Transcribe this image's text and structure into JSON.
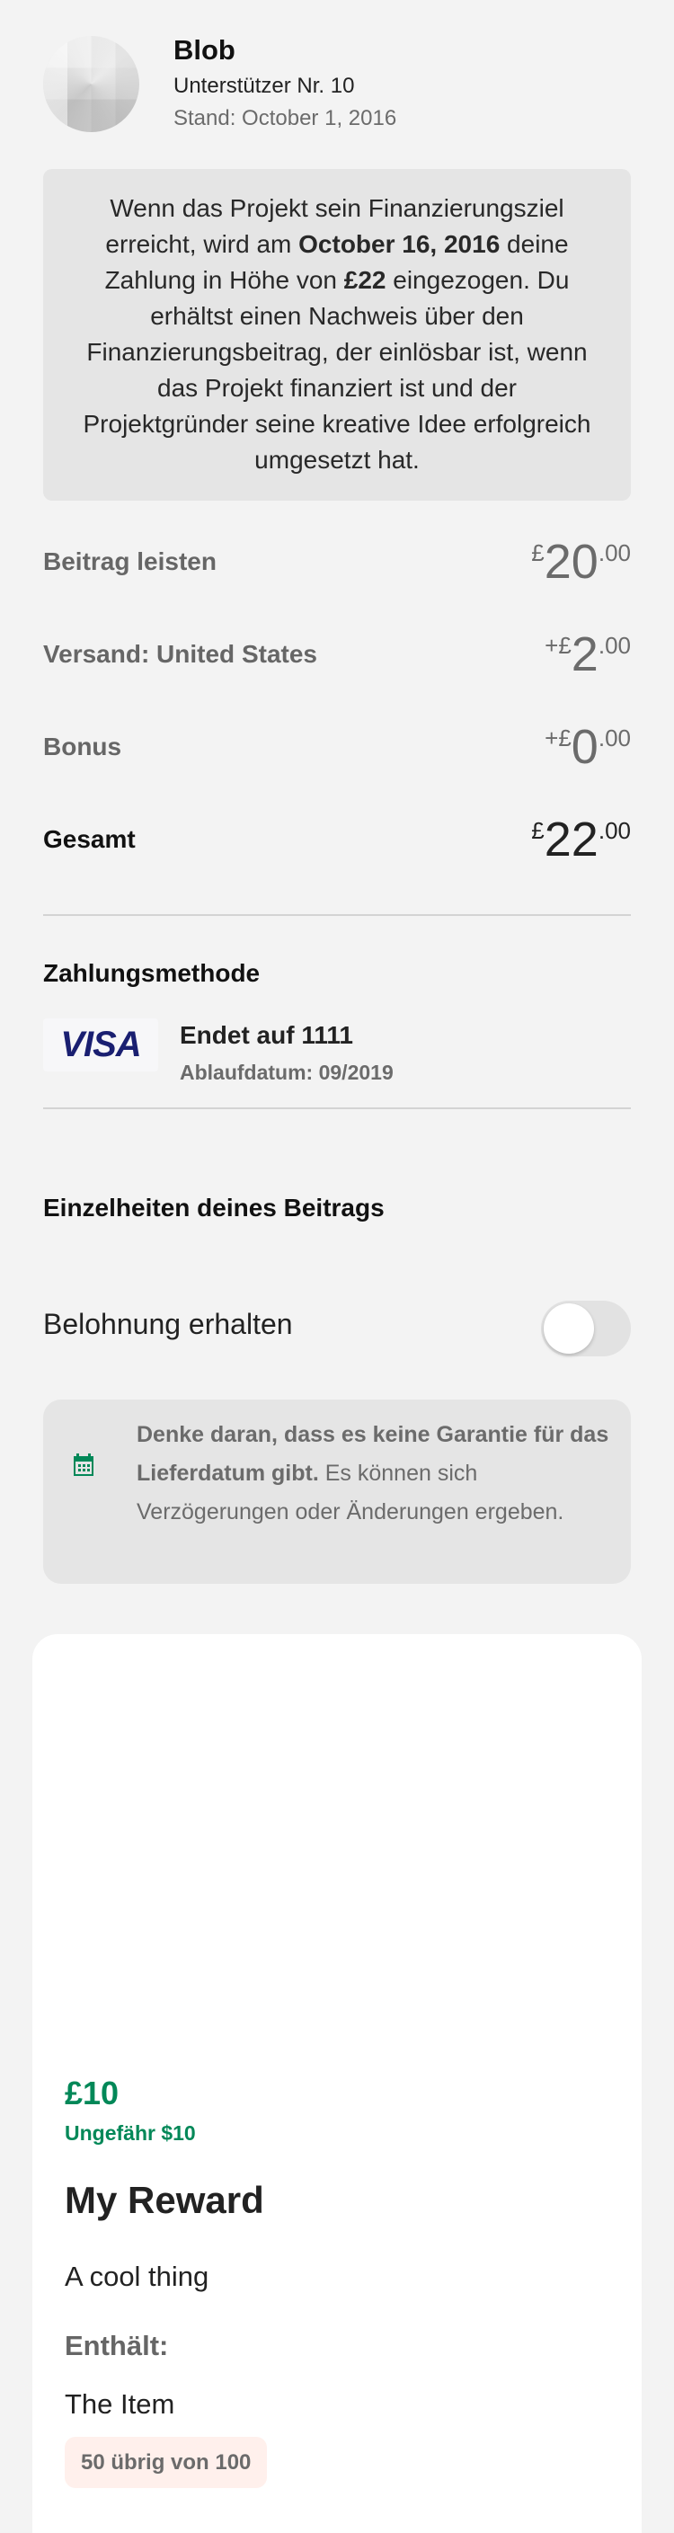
{
  "backer": {
    "name": "Blob",
    "number": "Unterstützer Nr. 10",
    "as_of": "Stand: October 1, 2016"
  },
  "info": {
    "t1": "Wenn das Projekt sein Finanzierungsziel erreicht, wird am ",
    "date": "October 16, 2016",
    "t2": " deine Zahlung in Höhe von ",
    "amount": "£22",
    "t3": " eingezogen. Du erhältst einen Nachweis über den Finanzierungsbeitrag, der einlösbar ist, wenn das Projekt finanziert ist und der Projektgründer seine kreative Idee erfolgreich umgesetzt hat."
  },
  "summary": [
    {
      "label": "Beitrag leisten",
      "prefix": "£",
      "whole": "20",
      "cents": ".00"
    },
    {
      "label": "Versand: United States",
      "prefix": "+£",
      "whole": "2",
      "cents": ".00"
    },
    {
      "label": "Bonus",
      "prefix": "+£",
      "whole": "0",
      "cents": ".00"
    },
    {
      "label": "Gesamt",
      "prefix": "£",
      "whole": "22",
      "cents": ".00"
    }
  ],
  "payment": {
    "heading": "Zahlungsmethode",
    "brand": "VISA",
    "ending": "Endet auf 1111",
    "expiry": "Ablaufdatum: 09/2019"
  },
  "details": {
    "heading": "Einzelheiten deines Beitrags",
    "reward_toggle_label": "Belohnung erhalten",
    "reward_toggle_on": false,
    "note_bold": "Denke daran, dass es keine Garantie für das Lieferdatum gibt.",
    "note_rest": " Es können sich Verzögerungen oder Änderungen ergeben."
  },
  "reward": {
    "price": "£10",
    "approx": "Ungefähr $10",
    "title": "My Reward",
    "description": "A cool thing",
    "contains_label": "Enthält:",
    "item": "The Item",
    "remaining": "50 übrig von 100"
  },
  "colors": {
    "accent": "#028858",
    "visa": "#1a1f71"
  }
}
